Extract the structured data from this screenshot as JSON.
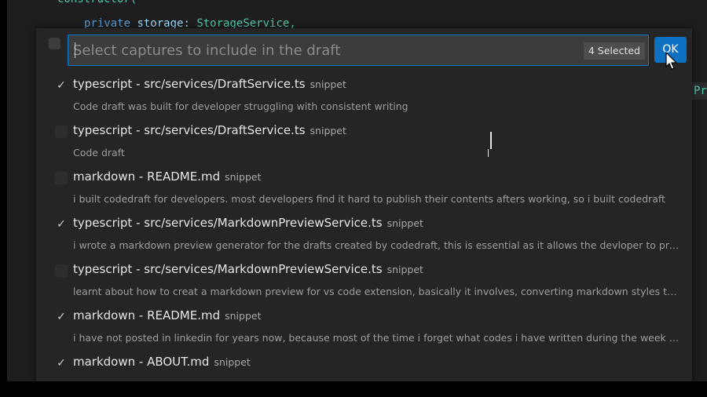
{
  "editor": {
    "code_line1": "constructor(",
    "code_line2_kw": "private",
    "code_line2_id": "storage",
    "code_line2_type": "StorageService,",
    "right_peek": "Pr"
  },
  "quickpick": {
    "placeholder": "Select captures to include in the draft",
    "selected_badge": "4 Selected",
    "ok_label": "OK",
    "items": [
      {
        "checked": true,
        "title": "typescript - src/services/DraftService.ts",
        "tag": "snippet",
        "desc": "Code draft was built for developer struggling with consistent writing"
      },
      {
        "checked": false,
        "title": "typescript - src/services/DraftService.ts",
        "tag": "snippet",
        "desc": "Code draft"
      },
      {
        "checked": false,
        "title": "markdown - README.md",
        "tag": "snippet",
        "desc": "i built codedraft for developers. most developers find it hard to publish their contents afters working, so i built codedraft"
      },
      {
        "checked": true,
        "title": "typescript - src/services/MarkdownPreviewService.ts",
        "tag": "snippet",
        "desc": "i wrote a markdown preview generator for the drafts created by codedraft, this is essential as it allows the devloper to previe..."
      },
      {
        "checked": false,
        "title": "typescript - src/services/MarkdownPreviewService.ts",
        "tag": "snippet",
        "desc": " learnt about how to creat a markdown preview for vs code extension, basically it involves, converting markdown styles to htm..."
      },
      {
        "checked": true,
        "title": "markdown - README.md",
        "tag": "snippet",
        "desc": " i have not posted in linkedin for years now, because most of the time i forget what codes i have written during the week and e..."
      },
      {
        "checked": true,
        "title": "markdown - ABOUT.md",
        "tag": "snippet",
        "desc": ""
      }
    ]
  },
  "icons": {
    "check": "check-icon",
    "cursor": "mouse-pointer-icon"
  },
  "colors": {
    "accent": "#0e70c0",
    "focus_border": "#007fd4",
    "panel_bg": "#252526",
    "editor_bg": "#1e1e1e"
  }
}
